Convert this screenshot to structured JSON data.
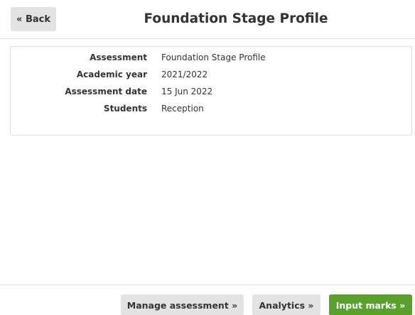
{
  "header": {
    "back_label": "« Back",
    "title": "Foundation Stage Profile"
  },
  "details": [
    {
      "label": "Assessment",
      "value": "Foundation Stage Profile"
    },
    {
      "label": "Academic year",
      "value": "2021/2022"
    },
    {
      "label": "Assessment date",
      "value": "15 Jun 2022"
    },
    {
      "label": "Students",
      "value": "Reception"
    }
  ],
  "footer": {
    "manage_label": "Manage assessment »",
    "analytics_label": "Analytics »",
    "input_marks_label": "Input marks »"
  },
  "colors": {
    "primary_button": "#5aa02c",
    "secondary_button": "#e3e3e3"
  }
}
